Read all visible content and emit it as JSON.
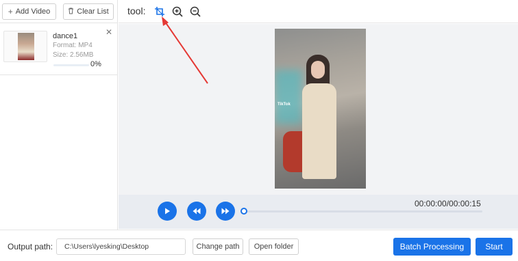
{
  "left_toolbar": {
    "add_video_label": "Add Video",
    "clear_list_label": "Clear List"
  },
  "file_list": [
    {
      "name": "dance1",
      "format": "Format:  MP4",
      "size": "Size:  2.56MB",
      "progress_text": "0%",
      "progress": 0
    }
  ],
  "tool_bar": {
    "label": "tool:",
    "icons": [
      "crop-icon",
      "zoom-in-icon",
      "zoom-out-icon"
    ]
  },
  "preview": {
    "watermark": "TikTok"
  },
  "player": {
    "time_text": "00:00:00/00:00:15",
    "position": 0
  },
  "bottom_bar": {
    "output_label": "Output path:",
    "output_path": "C:\\Users\\lyesking\\Desktop",
    "change_path_label": "Change path",
    "open_folder_label": "Open folder",
    "batch_label": "Batch Processing",
    "start_label": "Start"
  },
  "colors": {
    "accent": "#1a73e8",
    "annotation": "#e53935"
  }
}
